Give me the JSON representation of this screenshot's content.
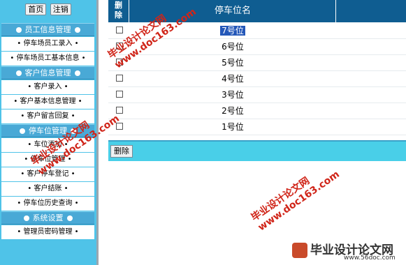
{
  "sidebar": {
    "home_label": "首页",
    "logout_label": "注销",
    "sections": [
      {
        "title": "员工信息管理",
        "items": [
          "• 停车场员工录入 •",
          "• 停车场员工基本信息 •"
        ]
      },
      {
        "title": "客户信息管理",
        "items": [
          "• 客户录入 •",
          "• 客户基本信息管理 •",
          "• 客户留言回复 •"
        ]
      },
      {
        "title": "停车位管理",
        "items": [
          "• 车位添加 •",
          "• 停车位管理 •",
          "• 客户停车登记 •",
          "• 客户结账 •",
          "• 停车位历史查询 •"
        ]
      },
      {
        "title": "系统设置",
        "items": [
          "• 管理员密码管理 •"
        ]
      }
    ]
  },
  "table": {
    "col_delete": "删除",
    "col_name": "停车位名",
    "rows": [
      "7号位",
      "6号位",
      "5号位",
      "4号位",
      "3号位",
      "2号位",
      "1号位"
    ],
    "selected_row": "7号位"
  },
  "actions": {
    "delete_label": "删除"
  },
  "watermark": {
    "lines": [
      "毕业设计论文网",
      "www.doc163.com"
    ],
    "logo_text": "毕业设计论文网",
    "logo_url": "www.56doc.com"
  },
  "colors": {
    "sidebar_bg": "#4fc3e8",
    "section_header": "#49a9d6",
    "table_header": "#0f5d91",
    "action_bar": "#49cfe8",
    "selection": "#2357b8",
    "watermark": "#d02418"
  }
}
